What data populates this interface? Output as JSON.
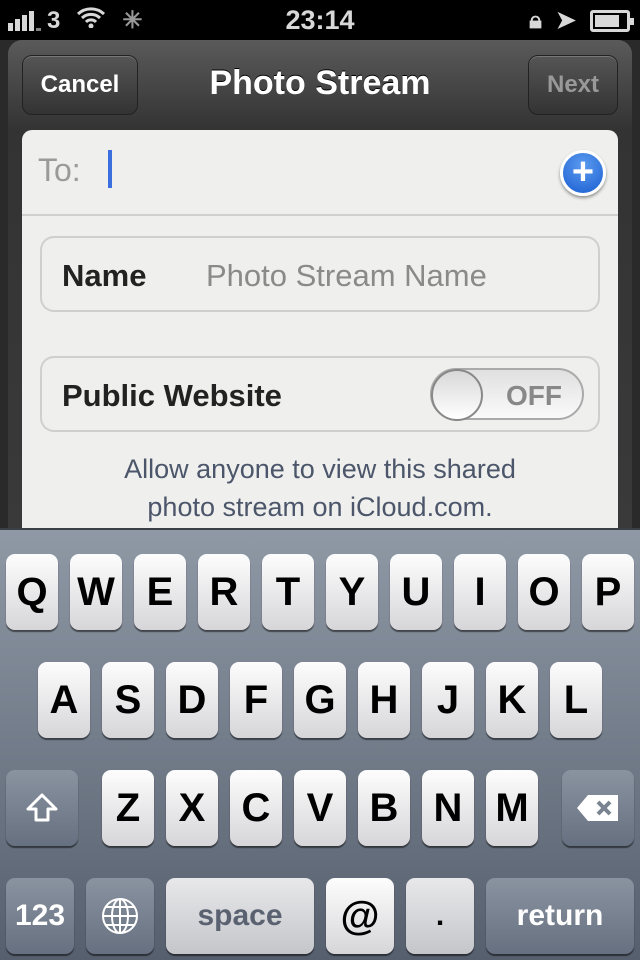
{
  "status_bar": {
    "carrier": "3",
    "time": "23:14",
    "icons": [
      "signal-icon",
      "wifi-icon",
      "activity-spinner-icon",
      "rotation-lock-icon",
      "location-icon",
      "battery-icon"
    ],
    "battery_level": 0.8
  },
  "nav": {
    "title": "Photo Stream",
    "cancel": "Cancel",
    "next": "Next"
  },
  "form": {
    "to_label": "To:",
    "to_value": "",
    "name_label": "Name",
    "name_placeholder": "Photo Stream Name",
    "public_label": "Public Website",
    "public_toggle": "OFF",
    "note": "Allow anyone to view this shared photo stream on iCloud.com."
  },
  "keyboard": {
    "row1": [
      "Q",
      "W",
      "E",
      "R",
      "T",
      "Y",
      "U",
      "I",
      "O",
      "P"
    ],
    "row2": [
      "A",
      "S",
      "D",
      "F",
      "G",
      "H",
      "J",
      "K",
      "L"
    ],
    "row3": [
      "Z",
      "X",
      "C",
      "V",
      "B",
      "N",
      "M"
    ],
    "numbers": "123",
    "space": "space",
    "at": "@",
    "dot": ".",
    "return": "return"
  },
  "colors": {
    "accent": "#3b6fe0",
    "keyboard_bg": "#6f7886"
  }
}
